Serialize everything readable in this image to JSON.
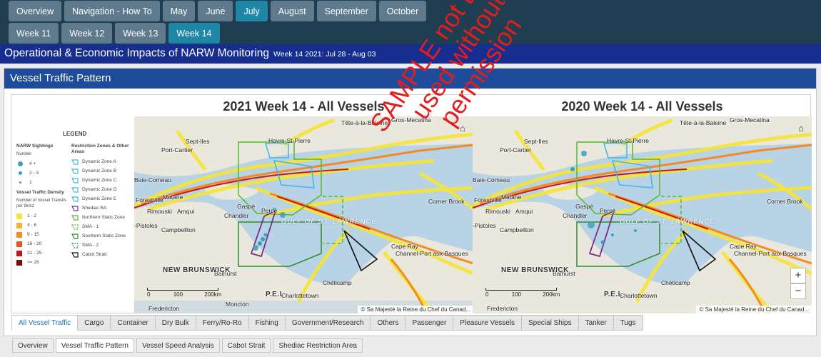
{
  "nav": {
    "row1": [
      "Overview",
      "Navigation - How To",
      "May",
      "June",
      "July",
      "August",
      "September",
      "October"
    ],
    "row2": [
      "Week 11",
      "Week 12",
      "Week 13",
      "Week 14"
    ]
  },
  "title": {
    "main": "Operational & Economic Impacts of NARW Monitoring",
    "sub": "Week 14 2021: Jul 28 - Aug 03"
  },
  "panel": {
    "header": "Vessel Traffic Pattern"
  },
  "legend": {
    "title": "LEGEND",
    "sightings_heading": "NARW Sightings",
    "sightings_subheading": "Number",
    "sightings": [
      "4 +",
      "2 - 3",
      "1"
    ],
    "density_heading": "Vessel Traffic Density",
    "density_subheading": "Number of Vessel Transits per 9km2",
    "density": [
      "1 - 2",
      "3 - 8",
      "9 - 15",
      "16 - 20",
      "21 - 25",
      ">= 26"
    ],
    "zones_heading": "Restriction Zones & Other Areas",
    "zones": [
      "Dynamic Zone A",
      "Dynamic Zone B",
      "Dynamic Zone C",
      "Dynamic Zone D",
      "Dynamic Zone E",
      "Shediac RA",
      "Northern Static Zone",
      "SMA - 1",
      "Southern Static Zone",
      "SMA - 2",
      "Cabot Strait"
    ]
  },
  "maps": {
    "left": {
      "title": "2021 Week 14 - All Vessels"
    },
    "right": {
      "title": "2020 Week 14 - All Vessels"
    },
    "places": {
      "gros": "Gros-Mecatina",
      "tete": "Tête-à-la-Baleine",
      "septiles": "Sept-Iles",
      "havre": "Havre-St-Pierre",
      "portcartier": "Port-Cartier",
      "baie": "Baie-Comeau",
      "matane": "Matane",
      "forestville": "Forestville",
      "rimouski": "Rimouski",
      "amqui": "Amqui",
      "pistoles": "-Pistoles",
      "campbellton": "Campbellton",
      "gaspe": "Gaspé",
      "chandler": "Chandler",
      "perce": "Percé",
      "gulf": "GULF OF ST. LAWRENCE",
      "cornerbrook": "Corner Brook",
      "caperay": "Cape Ray",
      "channel": "Channel-Port aux Basques",
      "bathurst": "Bathurst",
      "newbrunswick": "NEW BRUNSWICK",
      "cheticamp": "Chéticamp",
      "pei": "P.E.I.",
      "charlottetown": "Charlottetown",
      "moncton": "Moncton",
      "fredericton": "Fredericton"
    },
    "scale": [
      "0",
      "100",
      "200km"
    ],
    "attribution": "© Sa Majesté la Reine du Chef du Canad...",
    "home_icon": "⌂",
    "zoom_in": "+",
    "zoom_out": "−"
  },
  "watermark": "SAMPLE not to be used without permission",
  "vessel_tabs": [
    "All Vessel Traffic",
    "Cargo",
    "Container",
    "Dry Bulk",
    "Ferry/Ro-Ro",
    "Fishing",
    "Government/Research",
    "Others",
    "Passenger",
    "Pleasure Vessels",
    "Special Ships",
    "Tanker",
    "Tugs"
  ],
  "page_tabs": [
    "Overview",
    "Vessel Traffic Pattern",
    "Vessel Speed Analysis",
    "Cabot Strait",
    "Shediac Restriction Area"
  ],
  "colors": {
    "nav_bg": "#1f3e52",
    "nav_btn": "#5f7a8c",
    "nav_active": "#1e86a6",
    "title_bar": "#152e8f",
    "panel_header": "#1f4c9a",
    "density": [
      "#f5e536",
      "#f9b233",
      "#f58a1f",
      "#e8531c",
      "#c4161c",
      "#7a0a0a"
    ],
    "sighting": "#3aa0b8",
    "water": "#b8d2e6",
    "watermark": "#e11d1d"
  }
}
